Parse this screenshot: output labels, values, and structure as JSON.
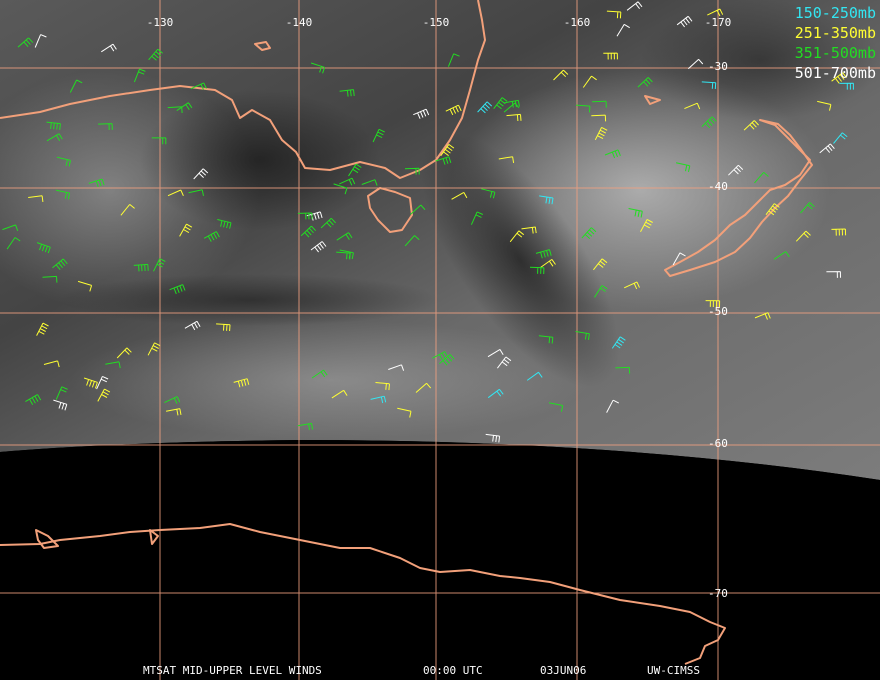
{
  "legend": [
    {
      "label": "150-250mb",
      "color": "#33e6f2"
    },
    {
      "label": "251-350mb",
      "color": "#ffff33"
    },
    {
      "label": "351-500mb",
      "color": "#22dd22"
    },
    {
      "label": "501-700mb",
      "color": "#ffffff"
    }
  ],
  "longitude_labels": [
    "-130",
    "-140",
    "-150",
    "-160",
    "-170"
  ],
  "latitude_labels": [
    "-30",
    "-40",
    "-50",
    "-60",
    "-70"
  ],
  "footer": {
    "product": "MTSAT MID-UPPER LEVEL WINDS",
    "time": "00:00 UTC",
    "date": "03JUN06",
    "credit": "UW-CIMSS"
  },
  "colors": {
    "grid": "#f0a080",
    "coast": "#f2a07a",
    "space": "#000000"
  }
}
